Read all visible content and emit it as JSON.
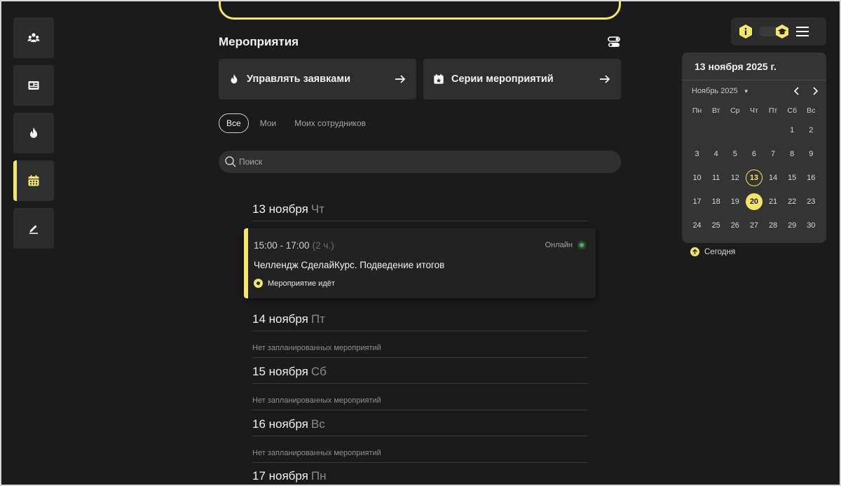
{
  "colors": {
    "accent": "#f5e56b",
    "background": "#1b1b1b",
    "card": "#2e2e2e",
    "online": "#4caf50"
  },
  "rail": [
    {
      "icon": "community-icon",
      "active": false
    },
    {
      "icon": "news-icon",
      "active": false
    },
    {
      "icon": "flame-icon",
      "active": false
    },
    {
      "icon": "calendar-icon",
      "active": true
    },
    {
      "icon": "edit-icon",
      "active": false
    }
  ],
  "events_section": {
    "title": "Мероприятия",
    "actions": [
      {
        "label": "Управлять заявками",
        "icon": "flame-icon"
      },
      {
        "label": "Серии мероприятий",
        "icon": "calendar-star-icon"
      }
    ],
    "filters": [
      "Все",
      "Мои",
      "Моих сотрудников"
    ],
    "active_filter": "Все",
    "search": {
      "placeholder": "Поиск",
      "value": ""
    }
  },
  "days": [
    {
      "date": "13 ноября",
      "weekday": "Чт"
    },
    {
      "date": "14 ноября",
      "weekday": "Пт",
      "empty": "Нет запланированных мероприятий"
    },
    {
      "date": "15 ноября",
      "weekday": "Сб",
      "empty": "Нет запланированных мероприятий"
    },
    {
      "date": "16 ноября",
      "weekday": "Вс",
      "empty": "Нет запланированных мероприятий"
    },
    {
      "date": "17 ноября",
      "weekday": "Пн"
    }
  ],
  "event": {
    "time": "15:00 - 17:00",
    "duration": "(2 ч.)",
    "mode": "Онлайн",
    "title": "Челлендж СделайКурс. Подведение итогов",
    "status": "Мероприятие идёт"
  },
  "calendar": {
    "current_date": "13 ноября 2025 г.",
    "month_label": "Ноябрь 2025",
    "caret": "▼",
    "weekdays": [
      "Пн",
      "Вт",
      "Ср",
      "Чт",
      "Пт",
      "Сб",
      "Вс"
    ],
    "weeks": [
      [
        "",
        "",
        "",
        "",
        "",
        "1",
        "2"
      ],
      [
        "3",
        "4",
        "5",
        "6",
        "7",
        "8",
        "9"
      ],
      [
        "10",
        "11",
        "12",
        "13",
        "14",
        "15",
        "16"
      ],
      [
        "17",
        "18",
        "19",
        "20",
        "21",
        "22",
        "23"
      ],
      [
        "24",
        "25",
        "26",
        "27",
        "28",
        "29",
        "30"
      ]
    ],
    "today": "13",
    "selected": "20",
    "today_link": "Сегодня"
  }
}
